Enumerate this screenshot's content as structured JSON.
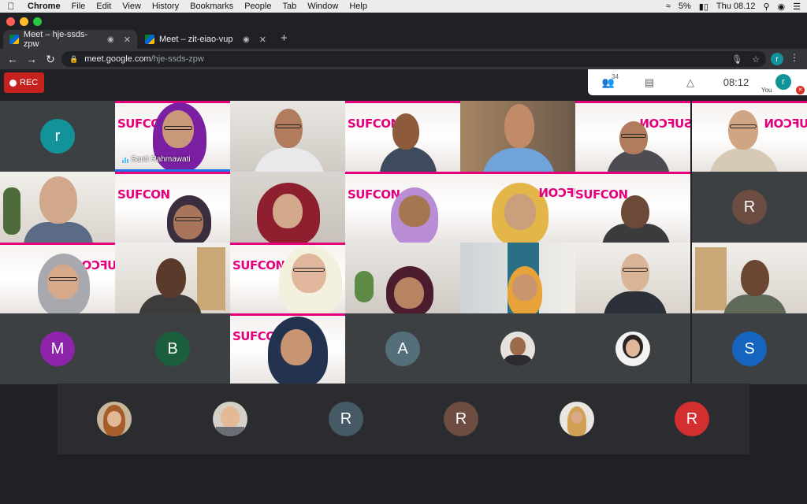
{
  "menubar": {
    "app": "Chrome",
    "items": [
      "File",
      "Edit",
      "View",
      "History",
      "Bookmarks",
      "People",
      "Tab",
      "Window",
      "Help"
    ],
    "battery": "5%",
    "clock": "Thu 08.12"
  },
  "tabs": [
    {
      "title": "Meet – hje-ssds-zpw",
      "active": true
    },
    {
      "title": "Meet – zit-eiao-vup",
      "active": false
    }
  ],
  "address": {
    "host": "meet.google.com",
    "path": "/hje-ssds-zpw",
    "profile_initial": "r"
  },
  "recording": {
    "label": "REC"
  },
  "meet_bar": {
    "participant_count": "34",
    "time": "08:12",
    "you_label": "You",
    "you_initial": "r"
  },
  "participants": {
    "speaker_name": "Santi Rahmawati",
    "avatars": [
      {
        "initial": "r",
        "color": "#12939a"
      },
      {
        "initial": "R",
        "color": "#6d4c41"
      },
      {
        "initial": "M",
        "color": "#8e24aa"
      },
      {
        "initial": "B",
        "color": "#1b5e3b"
      },
      {
        "initial": "A",
        "color": "#546e7a"
      },
      {
        "initial": "S",
        "color": "#1565c0"
      },
      {
        "initial": "R",
        "color": "#455a64"
      },
      {
        "initial": "R",
        "color": "#6d4c41"
      },
      {
        "initial": "R",
        "color": "#d32f2f"
      }
    ]
  },
  "poster": {
    "title": "SUFCON",
    "mirrored_title": "SUFCON"
  },
  "colors": {
    "accent": "#1a73e8",
    "rec": "#c5221f",
    "poster_pink": "#e4007c"
  }
}
